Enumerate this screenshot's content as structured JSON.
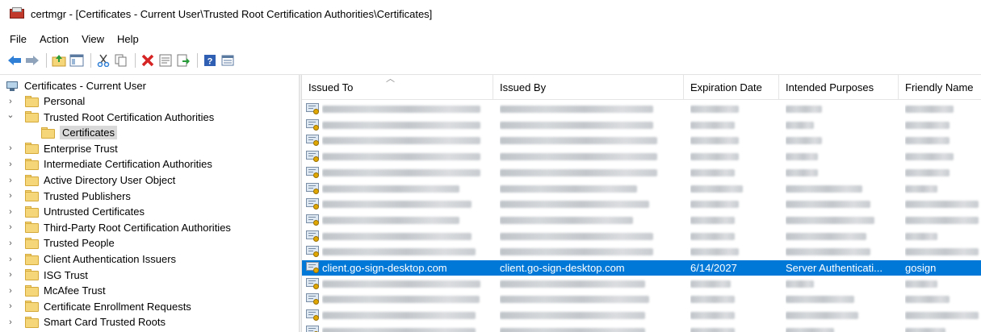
{
  "window": {
    "title": "certmgr - [Certificates - Current User\\Trusted Root Certification Authorities\\Certificates]"
  },
  "menu": [
    "File",
    "Action",
    "View",
    "Help"
  ],
  "toolbar": [
    "back-icon",
    "forward-icon",
    "up-folder-icon",
    "show-hide-tree-icon",
    "cut-icon",
    "copy-icon",
    "delete-icon",
    "properties-icon",
    "export-list-icon",
    "help-icon",
    "details-view-icon"
  ],
  "tree": {
    "root": "Certificates - Current User",
    "items": [
      {
        "label": "Personal",
        "expanded": false
      },
      {
        "label": "Trusted Root Certification Authorities",
        "expanded": true
      },
      {
        "label": "Certificates",
        "child": true,
        "selected": true
      },
      {
        "label": "Enterprise Trust",
        "expanded": false
      },
      {
        "label": "Intermediate Certification Authorities",
        "expanded": false
      },
      {
        "label": "Active Directory User Object",
        "expanded": false
      },
      {
        "label": "Trusted Publishers",
        "expanded": false
      },
      {
        "label": "Untrusted Certificates",
        "expanded": false
      },
      {
        "label": "Third-Party Root Certification Authorities",
        "expanded": false
      },
      {
        "label": "Trusted People",
        "expanded": false
      },
      {
        "label": "Client Authentication Issuers",
        "expanded": false
      },
      {
        "label": "ISG Trust",
        "expanded": false
      },
      {
        "label": "McAfee Trust",
        "expanded": false
      },
      {
        "label": "Certificate Enrollment Requests",
        "expanded": false
      },
      {
        "label": "Smart Card Trusted Roots",
        "expanded": false
      }
    ]
  },
  "list": {
    "columns": [
      "Issued To",
      "Issued By",
      "Expiration Date",
      "Intended Purposes",
      "Friendly Name"
    ],
    "sorted_column": "Issued To",
    "selected_row": {
      "issued_to": "client.go-sign-desktop.com",
      "issued_by": "client.go-sign-desktop.com",
      "expiration": "6/14/2027",
      "purposes": "Server Authenticati...",
      "friendly": "gosign"
    },
    "blurred_row_count": 14,
    "selected_row_index": 10
  },
  "colors": {
    "selection": "#0078d7",
    "folder": "#f5d77a"
  }
}
